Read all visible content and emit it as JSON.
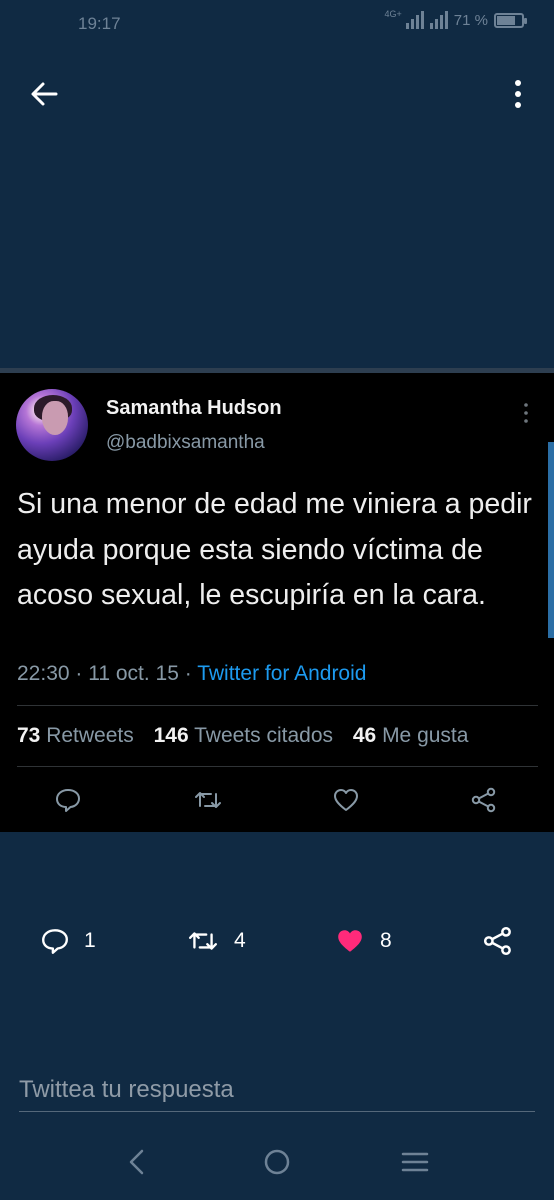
{
  "status_bar": {
    "time": "19:17",
    "network": "4G+",
    "battery_percent": "71 %"
  },
  "colors": {
    "background": "#102a43",
    "embed_background": "#000000",
    "link": "#1d9bf0",
    "like": "#ff2a7a"
  },
  "embed": {
    "author_name": "Samantha Hudson",
    "author_handle": "@badbixsamantha",
    "text": "Si una menor de edad me viniera a pedir ayuda porque esta siendo víctima de acoso sexual, le escupiría en la cara.",
    "time": "22:30",
    "date": "11 oct. 15",
    "source": "Twitter for Android",
    "retweets_count": "73",
    "retweets_label": "Retweets",
    "quotes_count": "146",
    "quotes_label": "Tweets citados",
    "likes_count": "46",
    "likes_label": "Me gusta"
  },
  "actions": {
    "reply_count": "1",
    "retweet_count": "4",
    "like_count": "8"
  },
  "reply": {
    "placeholder": "Twittea tu respuesta"
  },
  "icons": [
    "arrow-left-icon",
    "more-vertical-icon",
    "reply-icon",
    "retweet-icon",
    "heart-icon",
    "share-icon",
    "nav-back-icon",
    "nav-home-icon",
    "nav-menu-icon"
  ]
}
